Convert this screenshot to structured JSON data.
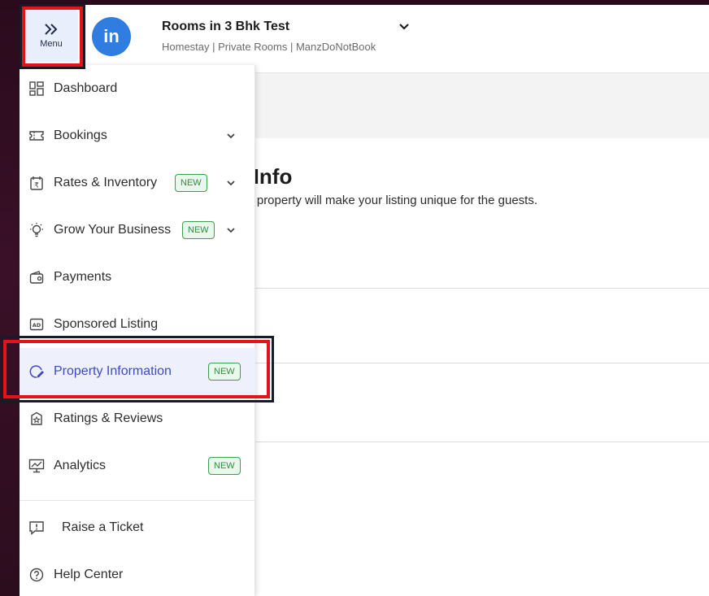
{
  "header": {
    "menu_label": "Menu",
    "avatar_text": "in",
    "property_name": "Rooms in 3 Bhk Test",
    "property_subtitle": "Homestay | Private Rooms | ManzDoNotBook"
  },
  "main": {
    "title_visible": "y Info",
    "description_visible": "our property will make your listing unique for the guests."
  },
  "sidebar": {
    "items": [
      {
        "label": "Dashboard",
        "icon": "dashboard-icon"
      },
      {
        "label": "Bookings",
        "icon": "ticket-icon",
        "has_chevron": true
      },
      {
        "label": "Rates & Inventory",
        "icon": "rupee-calendar-icon",
        "badge": "NEW",
        "has_chevron": true
      },
      {
        "label": "Grow Your Business",
        "icon": "lightbulb-icon",
        "badge": "NEW",
        "has_chevron": true
      },
      {
        "label": "Payments",
        "icon": "wallet-icon"
      },
      {
        "label": "Sponsored Listing",
        "icon": "ad-icon"
      },
      {
        "label": "Property Information",
        "icon": "property-edit-icon",
        "badge": "NEW",
        "active": true
      },
      {
        "label": "Ratings & Reviews",
        "icon": "rating-icon"
      },
      {
        "label": "Analytics",
        "icon": "analytics-icon",
        "badge": "NEW"
      }
    ],
    "footer": [
      {
        "label": "Raise a Ticket",
        "icon": "ticket-alert-icon"
      },
      {
        "label": "Help Center",
        "icon": "help-icon"
      }
    ]
  },
  "colors": {
    "accent": "#3b4cc0",
    "badge_green": "#2f8f3d",
    "highlight_red": "#e3131b",
    "avatar_blue": "#2f7de1"
  }
}
